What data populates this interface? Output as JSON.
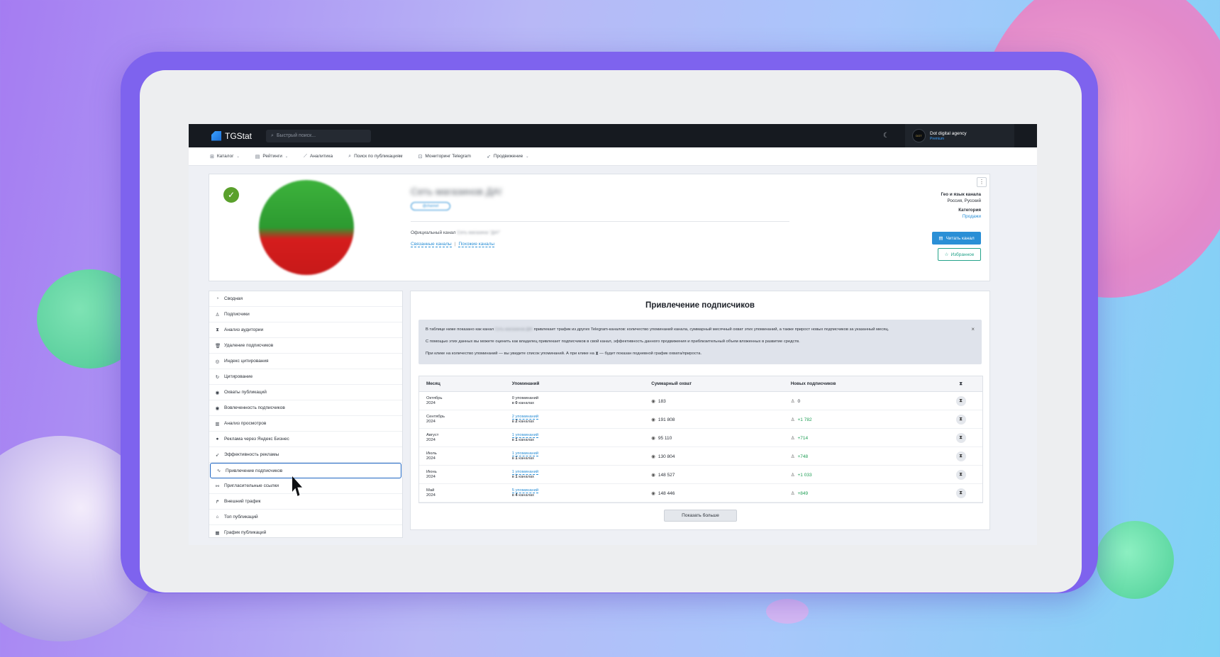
{
  "app": {
    "name": "TGStat"
  },
  "search": {
    "placeholder": "Быстрый поиск..."
  },
  "account": {
    "name": "Dot digital agency",
    "plan": "Premium",
    "avatar_text": "DOT"
  },
  "nav": [
    {
      "label": "Каталог",
      "icon": "grid-icon",
      "has_dropdown": true
    },
    {
      "label": "Рейтинги",
      "icon": "list-icon",
      "has_dropdown": true
    },
    {
      "label": "Аналитика",
      "icon": "chart-icon",
      "has_dropdown": false
    },
    {
      "label": "Поиск по публикациям",
      "icon": "search-icon",
      "has_dropdown": false
    },
    {
      "label": "Мониторинг Telegram",
      "icon": "monitor-icon",
      "has_dropdown": false
    },
    {
      "label": "Продвижение",
      "icon": "rocket-icon",
      "has_dropdown": true
    }
  ],
  "channel": {
    "title": "Сеть магазинов ДА!",
    "tag": "@channel",
    "official_label": "Официальный канал",
    "official_value": "Сеть магазина \"ДА!\"",
    "link_related": "Связанные каналы",
    "link_separator": "|",
    "link_similar": "Похожие каналы",
    "geo_label": "Гео и язык канала",
    "geo_value": "Россия, Русский",
    "category_label": "Категория",
    "category_value": "Продажи",
    "read_button": "Читать канал",
    "fav_button": "Избранное",
    "menu_icon": "more-vertical-icon"
  },
  "sidebar": {
    "active_index": 11,
    "items": [
      {
        "label": "Сводная",
        "icon": "◔"
      },
      {
        "label": "Подписчики",
        "icon": "♙"
      },
      {
        "label": "Анализ аудитории",
        "icon": "⧗"
      },
      {
        "label": "Удаление подписчиков",
        "icon": "🗑"
      },
      {
        "label": "Индекс цитирования",
        "icon": "◎"
      },
      {
        "label": "Цитирование",
        "icon": "↻"
      },
      {
        "label": "Охваты публикаций",
        "icon": "◉"
      },
      {
        "label": "Вовлеченность подписчиков",
        "icon": "◉"
      },
      {
        "label": "Анализ просмотров",
        "icon": "▥"
      },
      {
        "label": "Реклама через Яндекс Бизнес",
        "icon": "●"
      },
      {
        "label": "Эффективность рекламы",
        "icon": "➶"
      },
      {
        "label": "Привлечение подписчиков",
        "icon": "∿"
      },
      {
        "label": "Пригласительные ссылки",
        "icon": "⚯"
      },
      {
        "label": "Внешний трафик",
        "icon": "↱"
      },
      {
        "label": "Топ публикаций",
        "icon": "⌂"
      },
      {
        "label": "График публикаций",
        "icon": "▦"
      }
    ]
  },
  "main": {
    "title": "Привлечение подписчиков",
    "info_1_pre": "В таблице ниже показано как канал",
    "info_1_channel": "Сеть магазинов ДА!",
    "info_1_post": "привлекает трафик из других Telegram-каналов: количество упоминаний канала, суммарный месячный охват этих упоминаний, а также прирост новых подписчиков за указанный месяц.",
    "info_2": "С помощью этих данных вы можете оценить как владелец привлекает подписчиков в свой канал, эффективность данного продвижения и приблизительный объем вложенных в развитие средств.",
    "info_3_pre": "При клике на количество упоминаний — вы увидите список упоминаний. А при клике на",
    "info_3_icon": "⧗",
    "info_3_post": "— будет показан подневной график охвата/прироста.",
    "info_close": "×",
    "columns": [
      "Месяц",
      "Упоминаний",
      "Суммарный охват",
      "Новых подписчиков",
      "⧗"
    ],
    "rows": [
      {
        "month": "Октябрь",
        "year": "2024",
        "mentions": "0 упоминаний",
        "mentions_sub_pre": "в",
        "mentions_sub_num": "0",
        "mentions_sub_post": "каналах",
        "reach": "183",
        "new_subs": "0",
        "positive": false,
        "linked": false
      },
      {
        "month": "Сентябрь",
        "year": "2024",
        "mentions": "2 упоминаний",
        "mentions_sub_pre": "в",
        "mentions_sub_num": "2",
        "mentions_sub_post": "каналах",
        "reach": "191 808",
        "new_subs": "+1 782",
        "positive": true,
        "linked": true
      },
      {
        "month": "Август",
        "year": "2024",
        "mentions": "1 упоминаний",
        "mentions_sub_pre": "в",
        "mentions_sub_num": "1",
        "mentions_sub_post": "каналах",
        "reach": "95 110",
        "new_subs": "+714",
        "positive": true,
        "linked": true
      },
      {
        "month": "Июль",
        "year": "2024",
        "mentions": "1 упоминаний",
        "mentions_sub_pre": "в",
        "mentions_sub_num": "1",
        "mentions_sub_post": "каналах",
        "reach": "130 804",
        "new_subs": "+748",
        "positive": true,
        "linked": true
      },
      {
        "month": "Июнь",
        "year": "2024",
        "mentions": "1 упоминаний",
        "mentions_sub_pre": "в",
        "mentions_sub_num": "1",
        "mentions_sub_post": "каналах",
        "reach": "148 527",
        "new_subs": "+1 033",
        "positive": true,
        "linked": true
      },
      {
        "month": "Май",
        "year": "2024",
        "mentions": "5 упоминаний",
        "mentions_sub_pre": "в",
        "mentions_sub_num": "4",
        "mentions_sub_post": "каналах",
        "reach": "148 446",
        "new_subs": "+849",
        "positive": true,
        "linked": true
      }
    ],
    "more_button": "Показать больше"
  },
  "colors": {
    "accent": "#2a8fd6",
    "positive": "#1f9e55",
    "topbar": "#161a20",
    "frame": "#7e63ee"
  }
}
